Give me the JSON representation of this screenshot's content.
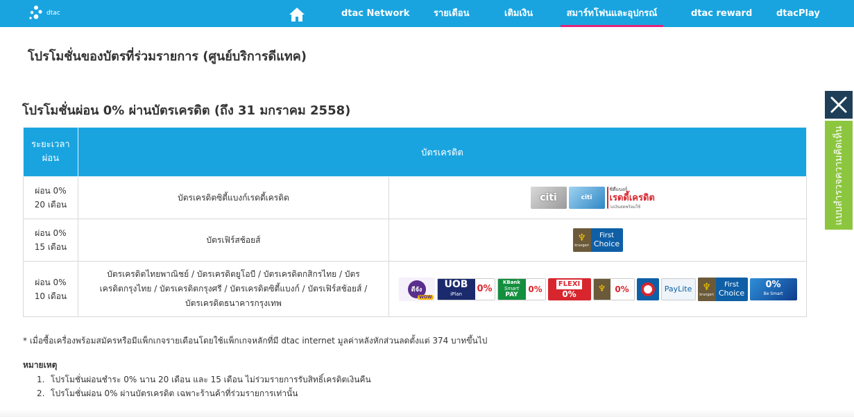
{
  "brand": {
    "logo_text": "dtac"
  },
  "nav": {
    "items": [
      {
        "label": "dtac Network"
      },
      {
        "label": "รายเดือน"
      },
      {
        "label": "เติมเงิน"
      },
      {
        "label": "สมาร์ทโฟนและอุปกรณ์"
      },
      {
        "label": "dtac reward"
      },
      {
        "label": "dtacPlay"
      }
    ],
    "active_index": 3
  },
  "page": {
    "title": "โปรโมชั่นของบัตรที่ร่วมรายการ (ศูนย์บริการดีแทค)",
    "section_title": "โปรโมชั่นผ่อน 0% ผ่านบัตรเครดิต (ถึง 31 มกราคม 2558)"
  },
  "table": {
    "header": {
      "period_line1": "ระยะเวลา",
      "period_line2": "ผ่อน",
      "cards": "บัตรเครดิต"
    },
    "rows": [
      {
        "period_line1": "ผ่อน 0%",
        "period_line2": "20 เดือน",
        "cards_line1": "บัตรเครดิตซิตี้แบงก์เรดดี้เครดิต",
        "cards_line2": "",
        "cards_line3": ""
      },
      {
        "period_line1": "ผ่อน 0%",
        "period_line2": "15 เดือน",
        "cards_line1": "บัตรเฟิร์สช้อยส์",
        "cards_line2": "",
        "cards_line3": ""
      },
      {
        "period_line1": "ผ่อน 0%",
        "period_line2": "10 เดือน",
        "cards_line1": "บัตรเครดิตไทยพาณิชย์ / บัตรเครดิตยูโอบี / บัตรเครดิตกสิกรไทย / บัตร",
        "cards_line2": "เครดิตกรุงไทย / บัตรเครดิตกรุงศรี / บัตรเครดิตซิตี้แบงก์ / บัตรเฟิร์สช้อยส์ /",
        "cards_line3": "บัตรเครดิตธนาคารกรุงเทพ"
      }
    ],
    "logos": {
      "citi": {
        "brand": "citi",
        "ready_line1": "ซิตี้แบงก์",
        "ready_main": "เรดดี้เครดิต",
        "ready_sub": "วงเงินสดพร้อมใช้"
      },
      "first_choice": {
        "krungsri": "krungsri",
        "line1": "First",
        "line2": "Choice"
      },
      "scb": {
        "text": "ดีจัง",
        "sub": "WOW"
      },
      "uob": {
        "text": "UOB",
        "sub": "iPlan",
        "zero": "0%"
      },
      "kbank": {
        "line1": "KBank",
        "line2": "Smart",
        "line3": "PAY",
        "zero": "0%"
      },
      "ktb": {
        "text": "FLEXI",
        "zero": "0%"
      },
      "krungsri_zero": {
        "zero": "0%"
      },
      "paylite": {
        "text": "PayLite"
      },
      "bbl": {
        "zero": "0%",
        "sub": "Be Smart"
      }
    }
  },
  "notes": {
    "footnote": "* เมื่อซื้อเครื่องพร้อมสมัครหรือมีแพ็กเกจรายเดือนโดยใช้แพ็กเกจหลักที่มี dtac internet มูลค่าหลังหักส่วนลดตั้งแต่ 374 บาทขึ้นไป",
    "remarks_title": "หมายเหตุ",
    "remarks": [
      {
        "num": "1.",
        "text": "โปรโมชั่นผ่อนชำระ 0% นาน 20 เดือน และ 15 เดือน ไม่ร่วมรายการรับสิทธิ์เครดิตเงินคืน"
      },
      {
        "num": "2.",
        "text": "โปรโมชั่นผ่อน 0% ผ่านบัตรเครดิต เฉพาะร้านค้าที่ร่วมรายการเท่านั้น"
      }
    ]
  },
  "feedback": {
    "label": "แบบสำรวจความคิดเห็น"
  },
  "colors": {
    "nav_bg": "#19a4e0",
    "active_underline": "#e2237e",
    "feedback_green": "#8cc63f",
    "close_navy": "#1f3f58"
  }
}
